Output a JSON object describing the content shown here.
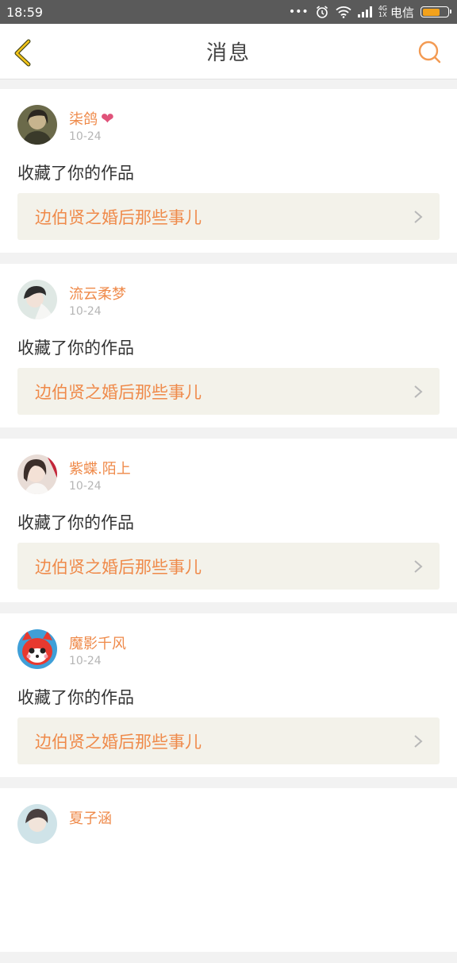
{
  "status_bar": {
    "time": "18:59",
    "dots": "•••",
    "network_top": "4G",
    "network_bottom": "1X",
    "carrier": "电信",
    "battery_level": 0.7,
    "battery_color": "#f3a21c"
  },
  "nav": {
    "title": "消息",
    "back_icon": "chevron-left-icon",
    "search_icon": "search-icon"
  },
  "colors": {
    "accent": "#ef8a4a",
    "heart": "#e0537a",
    "link_bg": "#f3f2ea"
  },
  "messages": [
    {
      "name": "柒鸽",
      "heart": "❤",
      "time": "10-24",
      "action": "收藏了你的作品",
      "work": "边伯贤之婚后那些事儿"
    },
    {
      "name": "流云柔梦",
      "heart": "",
      "time": "10-24",
      "action": "收藏了你的作品",
      "work": "边伯贤之婚后那些事儿"
    },
    {
      "name": "紫蝶.陌上",
      "heart": "",
      "time": "10-24",
      "action": "收藏了你的作品",
      "work": "边伯贤之婚后那些事儿"
    },
    {
      "name": "魔影千风",
      "heart": "",
      "time": "10-24",
      "action": "收藏了你的作品",
      "work": "边伯贤之婚后那些事儿"
    },
    {
      "name": "夏子涵",
      "heart": "",
      "time": "",
      "action": "",
      "work": ""
    }
  ]
}
